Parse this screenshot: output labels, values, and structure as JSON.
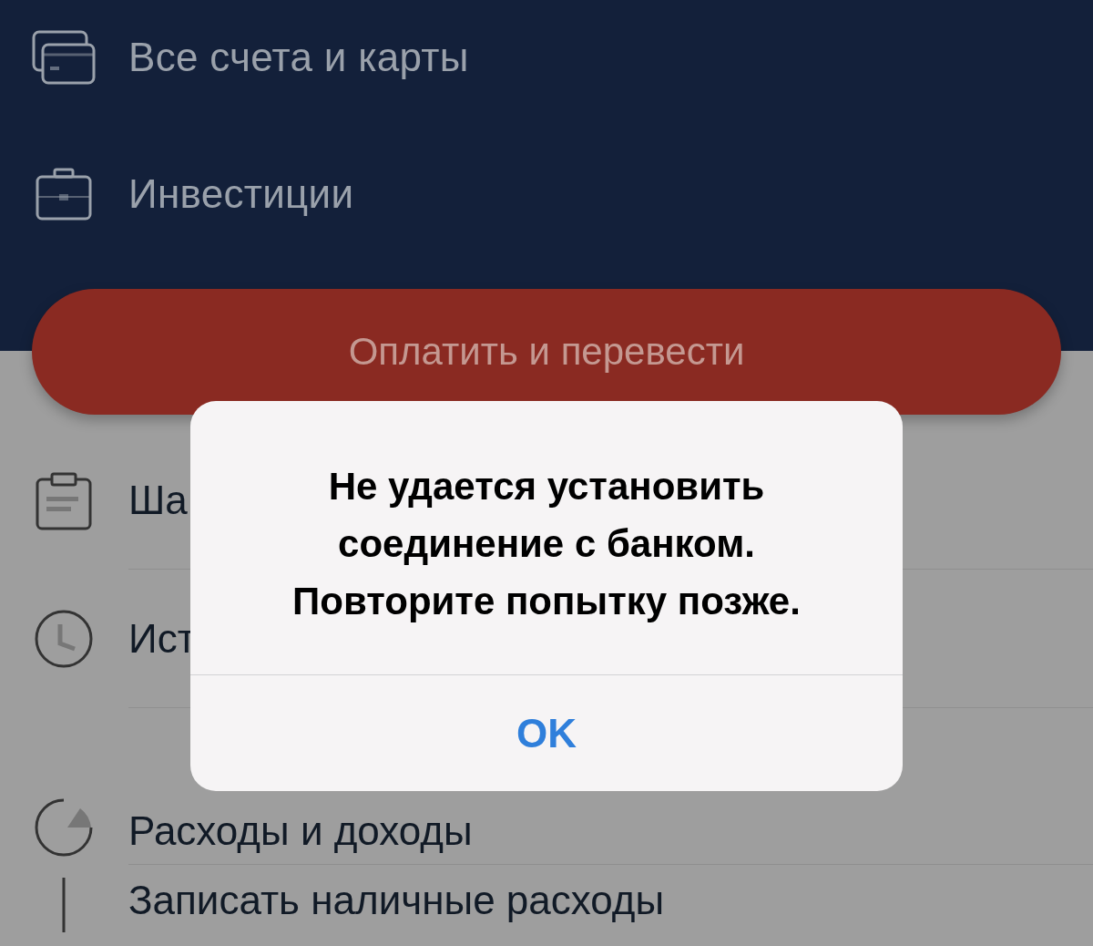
{
  "top_menu": [
    {
      "label": "Все счета и карты"
    },
    {
      "label": "Инвестиции"
    }
  ],
  "pay_button": {
    "label": "Оплатить и перевести"
  },
  "menu": [
    {
      "label": "Ша"
    },
    {
      "label": "Ист"
    },
    {
      "label": "Расходы и доходы"
    },
    {
      "label": "Записать наличные расходы"
    }
  ],
  "alert": {
    "message": "Не удается установить\nсоединение с банком.\nПовторите попытку позже.",
    "button": "OK"
  }
}
